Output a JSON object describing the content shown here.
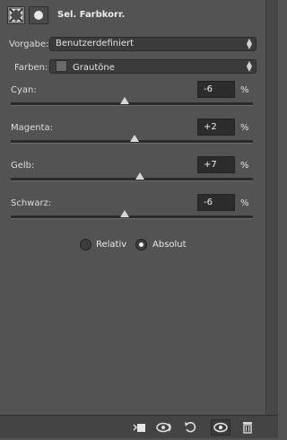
{
  "header": {
    "title": "Sel. Farbkorr."
  },
  "preset": {
    "label": "Vorgabe:",
    "value": "Benutzerdefiniert"
  },
  "colors": {
    "label": "Farben:",
    "value": "Grautöne"
  },
  "sliders": [
    {
      "label": "Cyan:",
      "value": "-6",
      "unit": "%",
      "level": -6
    },
    {
      "label": "Magenta:",
      "value": "+2",
      "unit": "%",
      "level": 2
    },
    {
      "label": "Gelb:",
      "value": "+7",
      "unit": "%",
      "level": 7
    },
    {
      "label": "Schwarz:",
      "value": "-6",
      "unit": "%",
      "level": -6
    }
  ],
  "method": {
    "relative_label": "Relativ",
    "absolute_label": "Absolut",
    "selected": "absolute"
  },
  "icons": [
    "adjustment-layer-icon",
    "mask-icon",
    "clip-to-layer-icon",
    "view-previous-state-icon",
    "reset-icon",
    "toggle-visibility-icon",
    "delete-icon"
  ]
}
